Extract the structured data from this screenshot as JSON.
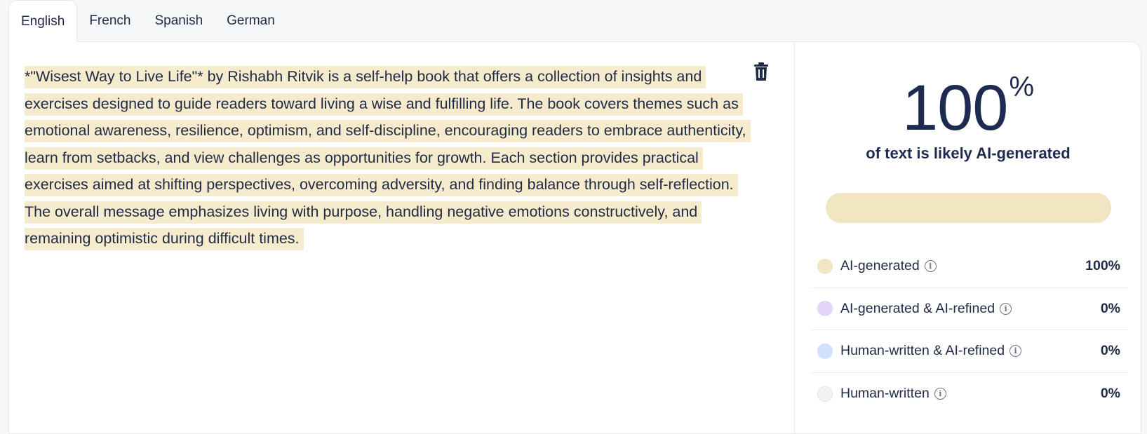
{
  "tabs": [
    {
      "label": "English",
      "active": true
    },
    {
      "label": "French",
      "active": false
    },
    {
      "label": "Spanish",
      "active": false
    },
    {
      "label": "German",
      "active": false
    }
  ],
  "editor": {
    "text": "*\"Wisest Way to Live Life\"* by Rishabh Ritvik is a self-help book that offers a collection of insights and exercises designed to guide readers toward living a wise and fulfilling life. The book covers themes such as emotional awareness, resilience, optimism, and self-discipline, encouraging readers to embrace authenticity, learn from setbacks, and view challenges as opportunities for growth. Each section provides practical exercises aimed at shifting perspectives, overcoming adversity, and finding balance through self-reflection. The overall message emphasizes living with purpose, handling negative emotions constructively, and remaining optimistic during difficult times.",
    "highlight_color": "#f7ebcd",
    "delete_icon": "trash-icon"
  },
  "result": {
    "percent": "100",
    "percent_sign": "%",
    "subtitle": "of text is likely AI-generated",
    "bar_fraction": 1.0,
    "bar_color": "#f2e5c1"
  },
  "legend": [
    {
      "label": "AI-generated",
      "value": "100%",
      "color": "#f3e6c3"
    },
    {
      "label": "AI-generated & AI-refined",
      "value": "0%",
      "color": "#e3d4fa"
    },
    {
      "label": "Human-written & AI-refined",
      "value": "0%",
      "color": "#cfe1fb"
    },
    {
      "label": "Human-written",
      "value": "0%",
      "color": "#f1f2f4"
    }
  ],
  "info_icon": "info-icon"
}
